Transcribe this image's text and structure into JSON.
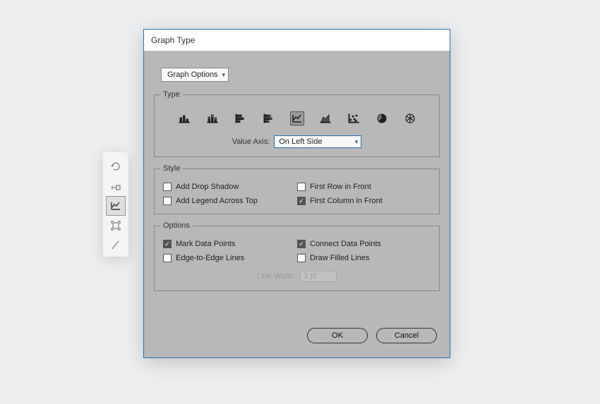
{
  "dialog": {
    "title": "Graph Type",
    "dropdown_label": "Graph Options",
    "group_type_label": "Type",
    "value_axis_label": "Value Axis:",
    "value_axis_value": "On Left Side",
    "group_style_label": "Style",
    "style": {
      "drop_shadow": "Add Drop Shadow",
      "first_row": "First Row in Front",
      "legend_top": "Add Legend Across Top",
      "first_col": "First Column in Front"
    },
    "group_options_label": "Options",
    "options": {
      "mark_points": "Mark Data Points",
      "connect_points": "Connect Data Points",
      "edge_lines": "Edge-to-Edge Lines",
      "filled_lines": "Draw Filled Lines"
    },
    "line_width_label": "Line Width:",
    "line_width_value": "3 pt",
    "ok": "OK",
    "cancel": "Cancel"
  },
  "graph_types": [
    "column",
    "stacked-column",
    "bar",
    "stacked-bar",
    "line",
    "area",
    "scatter",
    "pie",
    "radar"
  ],
  "graph_type_selected": "line"
}
